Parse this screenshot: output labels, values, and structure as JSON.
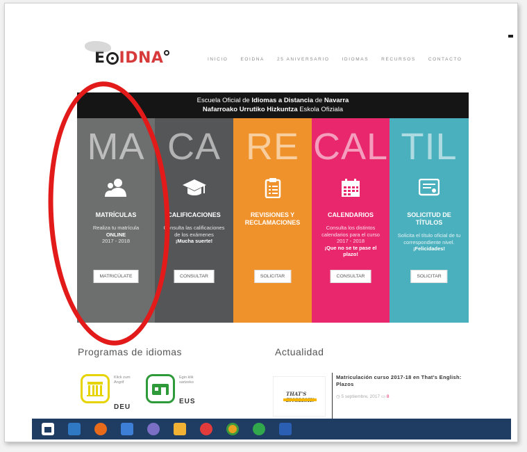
{
  "header": {
    "logo_text_a": "E",
    "logo_text_b": "IDNA",
    "nav": [
      "INICIO",
      "EOIDNA",
      "25 ANIVERSARIO",
      "IDIOMAS",
      "RECURSOS",
      "CONTACTO"
    ]
  },
  "band": {
    "line1_pre": "Escuela Oficial de ",
    "line1_bold1": "Idiomas a Distancia",
    "line1_mid": " de ",
    "line1_bold2": "Navarra",
    "line2_bold": "Nafarroako Urrutiko Hizkuntza",
    "line2_post": " Eskola Ofiziala"
  },
  "columns": [
    {
      "big": "MA",
      "title": "MATRÍCULAS",
      "desc1": "Realiza tu matrícula",
      "desc_bold": "ONLINE",
      "desc2": "2017 - 2018",
      "button": "MATRICÚLATE",
      "color": "#6d6e6e"
    },
    {
      "big": "CA",
      "title": "CALIFICACIONES",
      "desc1": "Consulta las calificaciones de los exámenes",
      "desc_bold": "¡Mucha suerte!",
      "desc2": "",
      "button": "CONSULTAR",
      "color": "#555657"
    },
    {
      "big": "RE",
      "title": "REVISIONES Y RECLAMACIONES",
      "desc1": "",
      "desc_bold": "",
      "desc2": "",
      "button": "SOLICITAR",
      "color": "#f0922b"
    },
    {
      "big": "CAL",
      "title": "CALENDARIOS",
      "desc1": "Consulta los distintos calendarios para el curso 2017 - 2018",
      "desc_bold": "¡Que no se te pase el plazo!",
      "desc2": "",
      "button": "CONSULTAR",
      "color": "#e8276d"
    },
    {
      "big": "TIL",
      "title": "SOLICITUD DE TÍTULOS",
      "desc1": "Solicita el título oficial de tu correspondiente nivel.",
      "desc_bold": "¡Felicidades!",
      "desc2": "",
      "button": "SOLICITAR",
      "color": "#4ab0bd"
    }
  ],
  "programs": {
    "title": "Programas de idiomas",
    "items": [
      {
        "desc": "Klick zum Angrif",
        "lang": "DEU",
        "color": "#e6d400"
      },
      {
        "desc": "Egin klik sartzeko",
        "lang": "EUS",
        "color": "#2e9a3a"
      }
    ]
  },
  "news": {
    "title": "Actualidad",
    "image_line": "THAT'S ENGLISH!",
    "headline": "Matriculación curso 2017-18 en That's English: Plazos",
    "date": "5 septiembre, 2017",
    "comments": "8"
  },
  "taskbar": {
    "icons": [
      "store-icon",
      "explorer-icon",
      "firefox-icon",
      "app-icon",
      "settings-icon",
      "folder-icon",
      "chrome-red-icon",
      "chrome-icon",
      "green-app-icon",
      "word-icon"
    ]
  }
}
